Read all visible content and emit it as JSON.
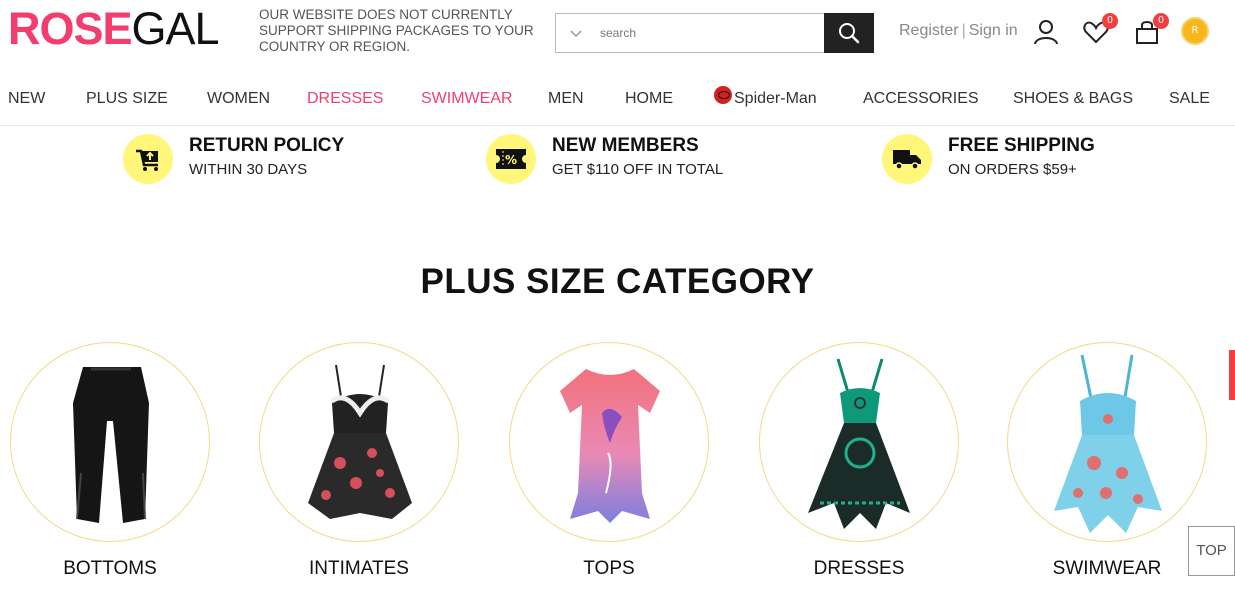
{
  "header": {
    "logo_part1": "ROSE",
    "logo_part2": "GAL",
    "notice": "OUR WEBSITE DOES NOT CURRENTLY SUPPORT SHIPPING PACKAGES TO YOUR COUNTRY OR REGION.",
    "search_placeholder": "search",
    "register": "Register",
    "separator": "|",
    "sign_in": "Sign in",
    "wishlist_count": "0",
    "cart_count": "0",
    "coin_label": "R"
  },
  "nav": {
    "items": [
      "NEW",
      "PLUS SIZE",
      "WOMEN",
      "DRESSES",
      "SWIMWEAR",
      "MEN",
      "HOME",
      "Spider-Man",
      "ACCESSORIES",
      "SHOES & BAGS",
      "SALE"
    ]
  },
  "features": [
    {
      "title": "RETURN POLICY",
      "subtitle": "WITHIN 30 DAYS",
      "icon": "cart-return-icon"
    },
    {
      "title": "NEW MEMBERS",
      "subtitle": "GET $110 OFF IN TOTAL",
      "icon": "coupon-icon"
    },
    {
      "title": "FREE SHIPPING",
      "subtitle": "ON ORDERS $59+",
      "icon": "truck-icon"
    }
  ],
  "section_title": "PLUS SIZE CATEGORY",
  "categories": [
    {
      "label": "BOTTOMS"
    },
    {
      "label": "INTIMATES"
    },
    {
      "label": "TOPS"
    },
    {
      "label": "DRESSES"
    },
    {
      "label": "SWIMWEAR"
    }
  ],
  "top_button": "TOP",
  "colors": {
    "brand": "#f23e6f",
    "feature_circle": "#fff67a",
    "ring": "#f3d98a"
  }
}
